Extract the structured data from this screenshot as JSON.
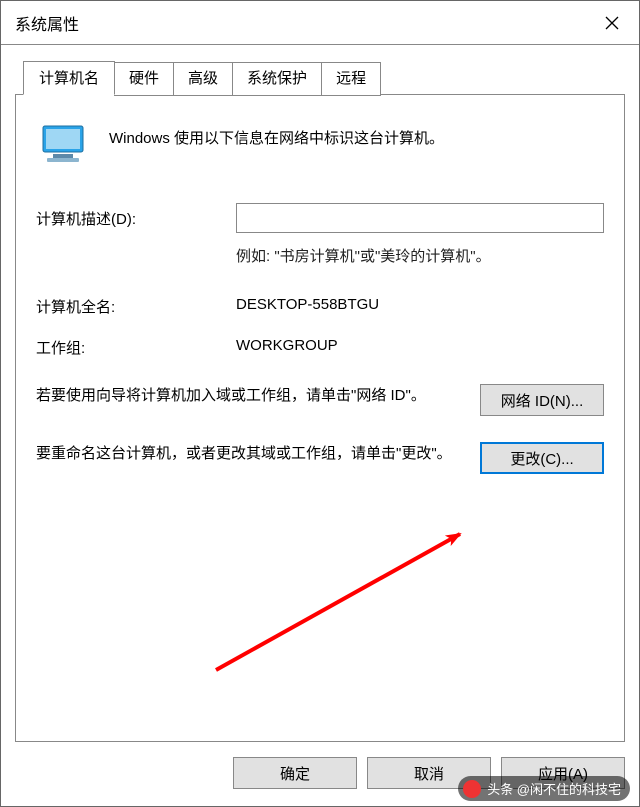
{
  "titlebar": {
    "title": "系统属性"
  },
  "tabs": {
    "items": [
      "计算机名",
      "硬件",
      "高级",
      "系统保护",
      "远程"
    ],
    "active": 0
  },
  "intro": "Windows 使用以下信息在网络中标识这台计算机。",
  "desc_label": "计算机描述(D):",
  "desc_value": "",
  "desc_hint": "例如: \"书房计算机\"或\"美玲的计算机\"。",
  "fullname_label": "计算机全名:",
  "fullname_value": "DESKTOP-558BTGU",
  "workgroup_label": "工作组:",
  "workgroup_value": "WORKGROUP",
  "netid_text": "若要使用向导将计算机加入域或工作组，请单击\"网络 ID\"。",
  "netid_button": "网络 ID(N)...",
  "change_text": "要重命名这台计算机，或者更改其域或工作组，请单击\"更改\"。",
  "change_button": "更改(C)...",
  "footer": {
    "ok": "确定",
    "cancel": "取消",
    "apply": "应用(A)"
  },
  "watermark": "头条 @闲不住的科技宅"
}
